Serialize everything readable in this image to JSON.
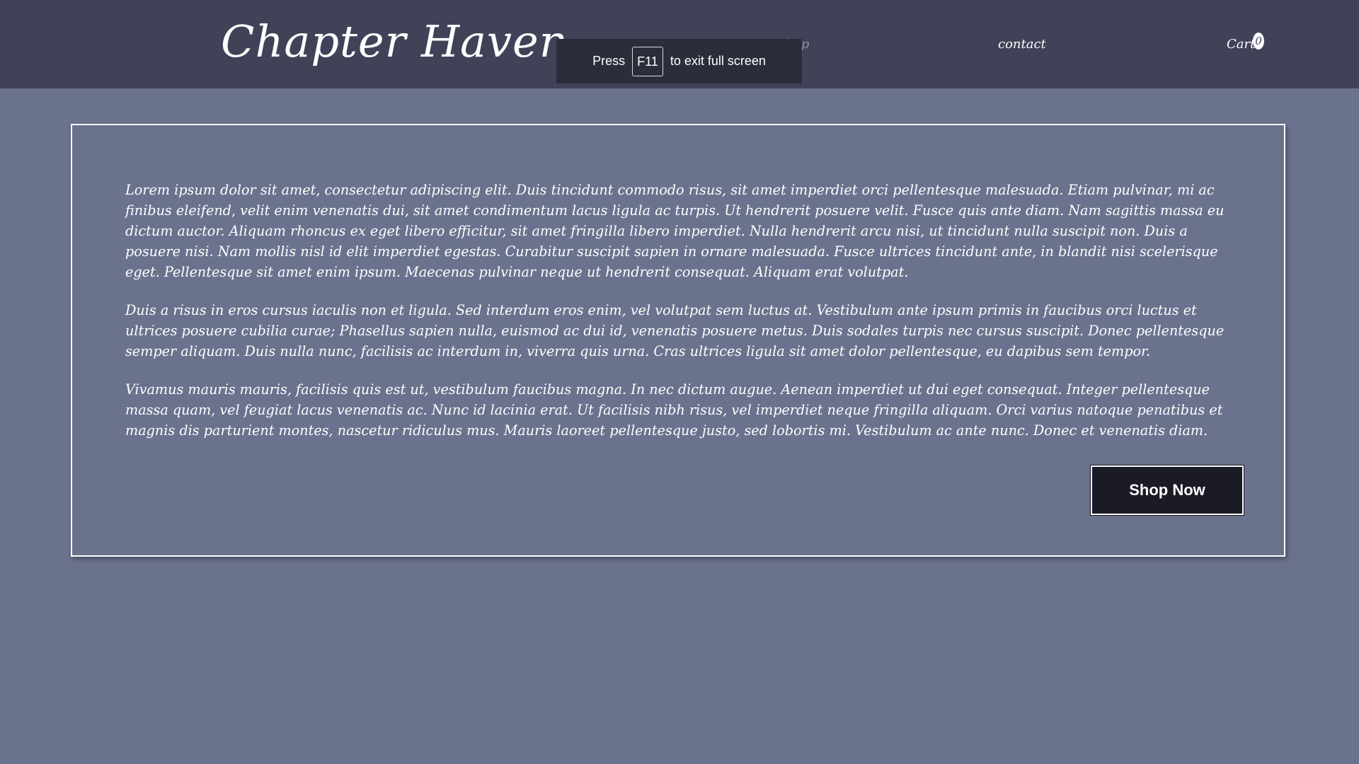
{
  "header": {
    "logo": "Chapter Haven",
    "nav": {
      "shop": "Shop",
      "contact": "contact",
      "cart": "Cart",
      "cart_count": "0"
    }
  },
  "fullscreen_notice": {
    "before": "Press",
    "key": "F11",
    "after": "to exit full screen"
  },
  "content": {
    "paragraphs": [
      "Lorem ipsum dolor sit amet, consectetur adipiscing elit. Duis tincidunt commodo risus, sit amet imperdiet orci pellentesque malesuada. Etiam pulvinar, mi ac finibus eleifend, velit enim venenatis dui, sit amet condimentum lacus ligula ac turpis. Ut hendrerit posuere velit. Fusce quis ante diam. Nam sagittis massa eu dictum auctor. Aliquam rhoncus ex eget libero efficitur, sit amet fringilla libero imperdiet. Nulla hendrerit arcu nisi, ut tincidunt nulla suscipit non. Duis a posuere nisi. Nam mollis nisl id elit imperdiet egestas. Curabitur suscipit sapien in ornare malesuada. Fusce ultrices tincidunt ante, in blandit nisi scelerisque eget. Pellentesque sit amet enim ipsum. Maecenas pulvinar neque ut hendrerit consequat. Aliquam erat volutpat.",
      "Duis a risus in eros cursus iaculis non et ligula. Sed interdum eros enim, vel volutpat sem luctus at. Vestibulum ante ipsum primis in faucibus orci luctus et ultrices posuere cubilia curae; Phasellus sapien nulla, euismod ac dui id, venenatis posuere metus. Duis sodales turpis nec cursus suscipit. Donec pellentesque semper aliquam. Duis nulla nunc, facilisis ac interdum in, viverra quis urna. Cras ultrices ligula sit amet dolor pellentesque, eu dapibus sem tempor.",
      "Vivamus mauris mauris, facilisis quis est ut, vestibulum faucibus magna. In nec dictum augue. Aenean imperdiet ut dui eget consequat. Integer pellentesque massa quam, vel feugiat lacus venenatis ac. Nunc id lacinia erat. Ut facilisis nibh risus, vel imperdiet neque fringilla aliquam. Orci varius natoque penatibus et magnis dis parturient montes, nascetur ridiculus mus. Mauris laoreet pellentesque justo, sed lobortis mi. Vestibulum ac ante nunc. Donec et venenatis diam."
    ],
    "cta_label": "Shop Now"
  },
  "colors": {
    "page_background": "#6b728e",
    "header_background": "#404258",
    "button_background": "#1b1b26",
    "text": "#ffffff"
  }
}
